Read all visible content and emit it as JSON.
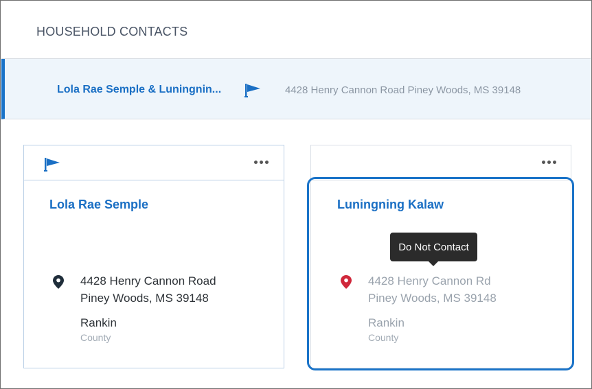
{
  "section": {
    "title": "HOUSEHOLD CONTACTS"
  },
  "household": {
    "name": "Lola Rae Semple & Luningnin...",
    "address": "4428 Henry Cannon Road Piney Woods, MS 39148",
    "flag_icon": "flag-icon"
  },
  "contacts": [
    {
      "name": "Lola Rae Semple",
      "address_line1": "4428 Henry Cannon Road",
      "address_line2": "Piney Woods, MS 39148",
      "county": "Rankin",
      "county_label": "County",
      "primary": true,
      "pin_color": "#1f2d3a"
    },
    {
      "name": "Luningning Kalaw",
      "address_line1": "4428 Henry Cannon Rd",
      "address_line2": "Piney Woods, MS 39148",
      "county": "Rankin",
      "county_label": "County",
      "primary": false,
      "pin_color": "#d0283b",
      "tooltip": "Do Not Contact"
    }
  ],
  "colors": {
    "accent": "#1a73c8",
    "link": "#1a6fc4",
    "alert": "#d0283b"
  }
}
